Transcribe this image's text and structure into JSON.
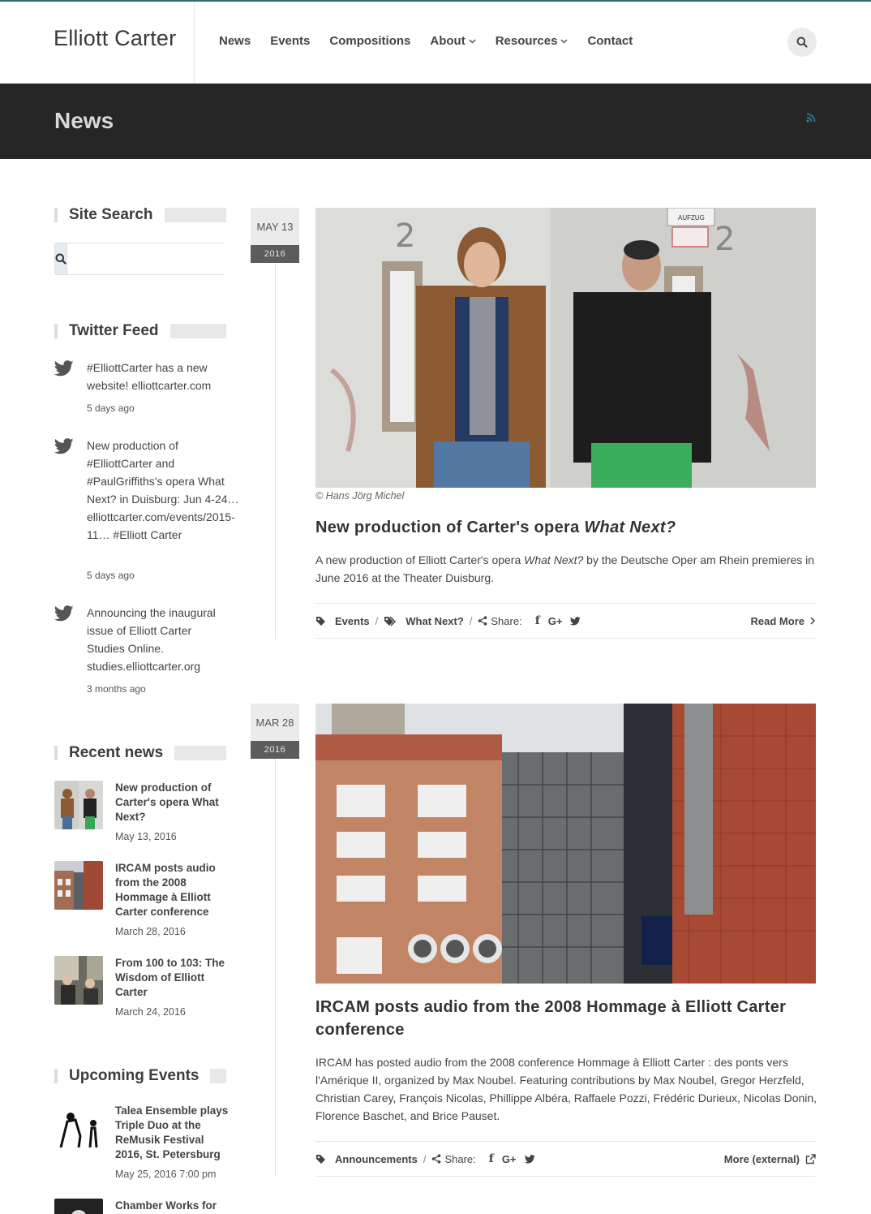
{
  "header": {
    "logo": "Elliott Carter",
    "nav": [
      {
        "label": "News",
        "dropdown": false
      },
      {
        "label": "Events",
        "dropdown": false
      },
      {
        "label": "Compositions",
        "dropdown": false
      },
      {
        "label": "About",
        "dropdown": true
      },
      {
        "label": "Resources",
        "dropdown": true
      },
      {
        "label": "Contact",
        "dropdown": false
      }
    ],
    "search_icon": "search-icon"
  },
  "titlebar": {
    "title": "News",
    "rss_icon": "rss-icon"
  },
  "sidebar": {
    "site_search": {
      "heading": "Site Search",
      "placeholder": ""
    },
    "twitter": {
      "heading": "Twitter Feed",
      "tweets": [
        {
          "text": "#ElliottCarter has a new website! elliottcarter.com",
          "ago": "5 days ago"
        },
        {
          "text": "New production of #ElliottCarter and #PaulGriffiths's opera What Next? in Duisburg: Jun 4-24… elliottcarter.com/events/2015-11… #Elliott Carter",
          "ago": "5 days ago"
        },
        {
          "text": "Announcing the inaugural issue of Elliott Carter Studies Online. studies.elliottcarter.org",
          "ago": "3 months ago"
        }
      ]
    },
    "recent_news": {
      "heading": "Recent news",
      "items": [
        {
          "title": "New production of Carter's opera What Next?",
          "date": "May 13, 2016"
        },
        {
          "title": "IRCAM posts audio from the 2008 Hommage à Elliott Carter conference",
          "date": "March 28, 2016"
        },
        {
          "title": "From 100 to 103: The Wisdom of Elliott Carter",
          "date": "March 24, 2016"
        }
      ]
    },
    "upcoming_events": {
      "heading": "Upcoming Events",
      "items": [
        {
          "title": "Talea Ensemble plays Triple Duo at the ReMusik Festival 2016, St. Petersburg",
          "date": "May 25, 2016 7:00 pm"
        },
        {
          "title": "Chamber Works for",
          "date": ""
        }
      ]
    }
  },
  "posts": [
    {
      "month_day": "MAY 13",
      "year": "2016",
      "caption": "© Hans Jörg Michel",
      "title_plain": "New production of Carter's opera ",
      "title_italic": "What Next?",
      "excerpt_a": "A new production of Elliott Carter's opera ",
      "excerpt_italic": "What Next?",
      "excerpt_b": " by the Deutsche Oper am Rhein premieres in June 2016 at the Theater Duisburg.",
      "category": "Events",
      "tag": "What Next?",
      "share_label": "Share:",
      "action": "Read More"
    },
    {
      "month_day": "MAR 28",
      "year": "2016",
      "title": "IRCAM posts audio from the 2008 Hommage à Elliott Carter conference",
      "excerpt": "IRCAM has posted audio from the 2008 conference Hommage à Elliott Carter : des ponts vers l'Amérique II, organized by Max Noubel. Featuring contributions by Max Noubel, Gregor Herzfeld, Christian Carey, François Nicolas, Phillippe Albéra, Raffaele Pozzi, Frédéric Durieux, Nicolas Donin, Florence Baschet, and Brice Pauset.",
      "category": "Announcements",
      "share_label": "Share:",
      "action": "More (external)"
    }
  ],
  "colors": {
    "accent_line": "#2e6f74",
    "titlebar_bg": "#262626",
    "rss": "#2e7fa8"
  }
}
